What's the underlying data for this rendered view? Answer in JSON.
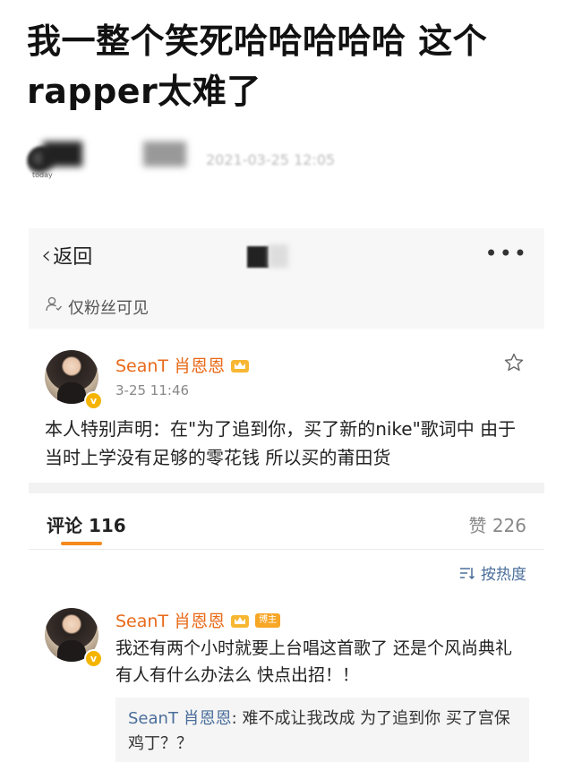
{
  "headline": {
    "line1": "我一整个笑死哈哈哈哈哈 这个",
    "line2": "rapper太难了"
  },
  "author_row": {
    "sub_caption": "today",
    "meta_blurred": "2021-03-25 12:05"
  },
  "navbar": {
    "back_label": "返回",
    "more_label": "•••"
  },
  "visibility": {
    "label": "仅粉丝可见"
  },
  "post": {
    "username": "SeanT 肖恩恩",
    "time": "3-25 11:46",
    "verified_mark": "v",
    "text": "本人特别声明：在\"为了追到你，买了新的nike\"歌词中 由于当时上学没有足够的零花钱 所以买的莆田货"
  },
  "tabs": {
    "comments_label": "评论",
    "comments_count": "116",
    "likes_label": "赞",
    "likes_count": "226"
  },
  "sort": {
    "label": "按热度"
  },
  "comment": {
    "username": "SeanT 肖恩恩",
    "badge": "博主",
    "verified_mark": "v",
    "text": "我还有两个小时就要上台唱这首歌了  还是个风尚典礼  有人有什么办法么  快点出招！！",
    "reply_name": "SeanT 肖恩恩",
    "reply_text": ": 难不成让我改成 为了追到你 买了宫保鸡丁？？"
  },
  "colors": {
    "username": "#e86a19",
    "link": "#4a6e9a",
    "tab_underline": "#f68a1e",
    "badge": "#f7a626"
  }
}
